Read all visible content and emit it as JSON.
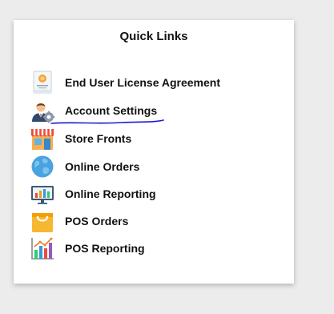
{
  "panel": {
    "title": "Quick Links"
  },
  "links": [
    {
      "label": "End User License Agreement",
      "icon": "certificate-icon"
    },
    {
      "label": "Account Settings",
      "icon": "user-settings-icon"
    },
    {
      "label": "Store Fronts",
      "icon": "storefront-icon"
    },
    {
      "label": "Online Orders",
      "icon": "globe-icon"
    },
    {
      "label": "Online Reporting",
      "icon": "monitor-chart-icon"
    },
    {
      "label": "POS Orders",
      "icon": "shopping-bag-icon"
    },
    {
      "label": "POS Reporting",
      "icon": "bar-chart-icon"
    }
  ],
  "annotation": {
    "underline_color": "#1a1ad6"
  }
}
